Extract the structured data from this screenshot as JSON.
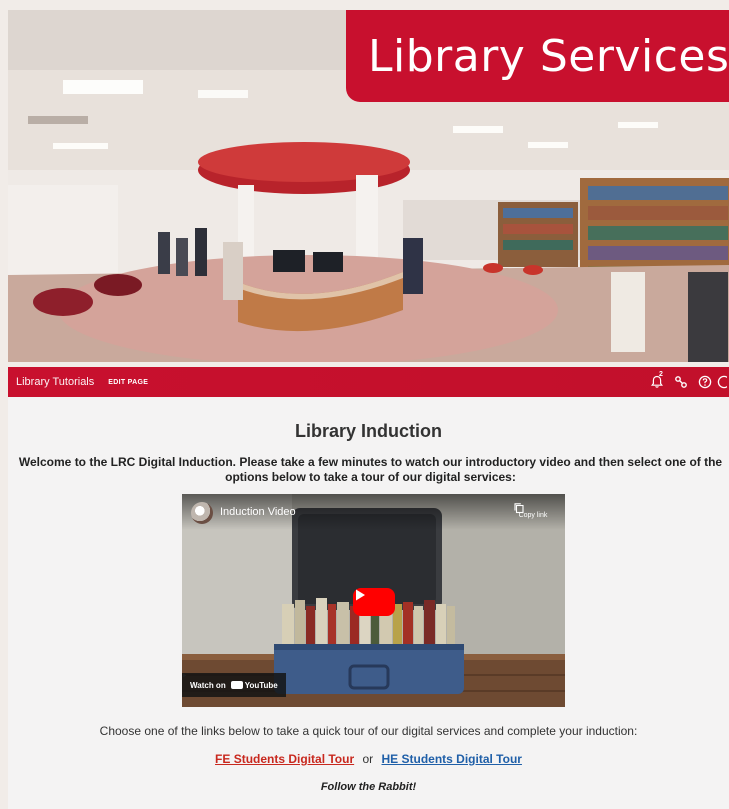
{
  "hero": {
    "title": "Library Services",
    "accent_color": "#c8102e"
  },
  "navbar": {
    "title": "Library Tutorials",
    "edit_label": "EDIT PAGE",
    "notification_count": "2",
    "icons": [
      "bell-icon",
      "link-icon",
      "help-icon",
      "profile-icon"
    ]
  },
  "main": {
    "heading": "Library Induction",
    "intro": "Welcome to the LRC Digital Induction.  Please take a few minutes to watch our introductory video and then select one of the options below to take a tour of our digital services:",
    "video": {
      "title": "Induction Video",
      "copy_link_label": "Copy link",
      "watch_on_label": "Watch on",
      "youtube_label": "YouTube"
    },
    "choose_text": "Choose one of the links below to take a quick tour of our digital services and complete your induction:",
    "fe_link": "FE Students Digital Tour",
    "or_text": "or",
    "he_link": "HE Students Digital Tour",
    "rabbit_text": "Follow the Rabbit!"
  }
}
